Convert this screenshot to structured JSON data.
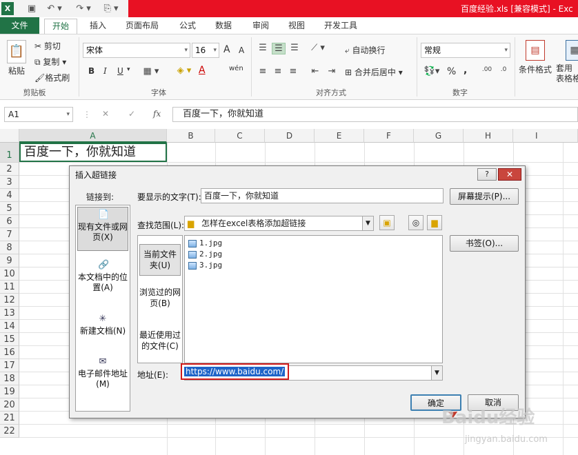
{
  "titlebar": {
    "title": "百度经验.xls  [兼容模式] - Exc",
    "qat": [
      "X",
      "💾",
      "↶",
      "↷",
      "⎙"
    ]
  },
  "tabs": [
    "文件",
    "开始",
    "插入",
    "页面布局",
    "公式",
    "数据",
    "审阅",
    "视图",
    "开发工具"
  ],
  "ribbon": {
    "clipboard": {
      "paste": "粘贴",
      "cut": "剪切",
      "copy": "复制",
      "format_painter": "格式刷",
      "label": "剪贴板"
    },
    "font": {
      "name": "宋体",
      "size": "16",
      "bold": "B",
      "italic": "I",
      "underline": "U",
      "label": "字体",
      "grow": "A",
      "shrink": "A",
      "wen": "wén",
      "color_a": "A"
    },
    "alignment": {
      "wrap": "自动换行",
      "merge": "合并后居中",
      "label": "对齐方式"
    },
    "number": {
      "format": "常规",
      "percent": "%",
      "comma": ",",
      "label": "数字"
    },
    "styles": {
      "conditional": "条件格式",
      "table": "套用\n表格格式"
    }
  },
  "formula_bar": {
    "name_box": "A1",
    "cancel": "✕",
    "enter": "✓",
    "fx": "fx",
    "value": "百度一下，你就知道"
  },
  "grid": {
    "columns": [
      "A",
      "B",
      "C",
      "D",
      "E",
      "F",
      "G",
      "H",
      "I"
    ],
    "rows": [
      "1",
      "2",
      "3",
      "4",
      "5",
      "6",
      "7",
      "8",
      "9",
      "10",
      "11",
      "12",
      "13",
      "14",
      "15",
      "16",
      "17",
      "18",
      "19",
      "20",
      "21",
      "22"
    ],
    "a1_value": "百度一下，你就知道"
  },
  "dialog": {
    "title": "插入超链接",
    "help": "?",
    "close": "✕",
    "link_to_label": "链接到:",
    "link_to_items": [
      {
        "label": "现有文件或网页(X)",
        "icon": "📄"
      },
      {
        "label": "本文档中的位置(A)",
        "icon": "🔗"
      },
      {
        "label": "新建文档(N)",
        "icon": "✳"
      },
      {
        "label": "电子邮件地址(M)",
        "icon": "✉"
      }
    ],
    "display_text_label": "要显示的文字(T):",
    "display_text_value": "百度一下，你就知道",
    "screen_tip_button": "屏幕提示(P)...",
    "look_in_label": "查找范围(L):",
    "look_in_value": "怎样在excel表格添加超链接",
    "bookmark_button": "书签(O)...",
    "subnav": [
      "当前文件夹(U)",
      "浏览过的网页(B)",
      "最近使用过的文件(C)"
    ],
    "files": [
      "1.jpg",
      "2.jpg",
      "3.jpg"
    ],
    "address_label": "地址(E):",
    "address_value": "https://www.baidu.com/",
    "ok_button": "确定",
    "cancel_button": "取消"
  },
  "watermark": {
    "main": "Baidu经验",
    "sub": "jingyan.baidu.com"
  },
  "colors": {
    "excel_green": "#217346",
    "title_red": "#e81123",
    "selection_blue": "#1e64c8",
    "highlight_red": "#d11a1a"
  }
}
